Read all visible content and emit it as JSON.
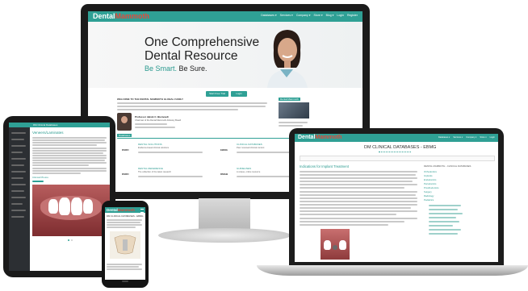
{
  "monitor": {
    "logo_dental": "Dental",
    "logo_mammoth": "Mammoth",
    "nav": [
      "Databases ▾",
      "Services ▾",
      "Company ▾",
      "Store ▾",
      "Blog ▾",
      "Login",
      "Register"
    ],
    "hero_title": "One Comprehensive",
    "hero_title2": "Dental Resource",
    "tagline_a": "Be Smart.",
    "tagline_b": "Be Sure.",
    "btn_start": "Start Free Trial",
    "btn_login": "Login",
    "welcome_heading": "WELCOME TO THE DENTAL MAMMOTH GLOBAL FAMILY",
    "profile_name": "Professor Jakob C. Bienvault",
    "profile_role": "Chairman of the Dental Mammoth Advisory Board",
    "side_heading": "Dental Mammoth",
    "card_heading": "Databases",
    "cards": [
      {
        "tag": "DSRD",
        "title": "DENTAL SOLUTIONS",
        "desc": "Evidence-based clinical solutions"
      },
      {
        "tag": "EBMG",
        "title": "CLINICAL DATABASES",
        "desc": "Peer reviewed clinical content"
      },
      {
        "tag": "DSRD",
        "title": "DENTAL REFERENCE",
        "desc": "The collection of the latest research"
      },
      {
        "tag": "DMGB",
        "title": "GUIDELINES",
        "desc": "A unique, online resource"
      }
    ]
  },
  "laptop": {
    "logo_dental": "Dental",
    "logo_mammoth": "Mammoth",
    "page_title": "DM CLINICAL DATABASES - EBMG",
    "article_title": "Indications for Implant Treatment",
    "sidebar_heading": "DENTAL MAMMOTH - CLINICAL DATABASES",
    "sidebar_items": [
      "Orthodontics",
      "Implants",
      "Endodontics",
      "Periodontics",
      "Prosthodontics",
      "Surgery",
      "Radiology",
      "Pediatrics"
    ]
  },
  "tablet": {
    "toolbar_text": "DM Clinical Databases",
    "heading": "Veneers/Laminates",
    "link": "Clinical Photos"
  },
  "phone": {
    "logo_dental": "Dental",
    "logo_mammoth": "Mammoth",
    "title": "DM CLINICAL DATABASES - EBMG"
  }
}
